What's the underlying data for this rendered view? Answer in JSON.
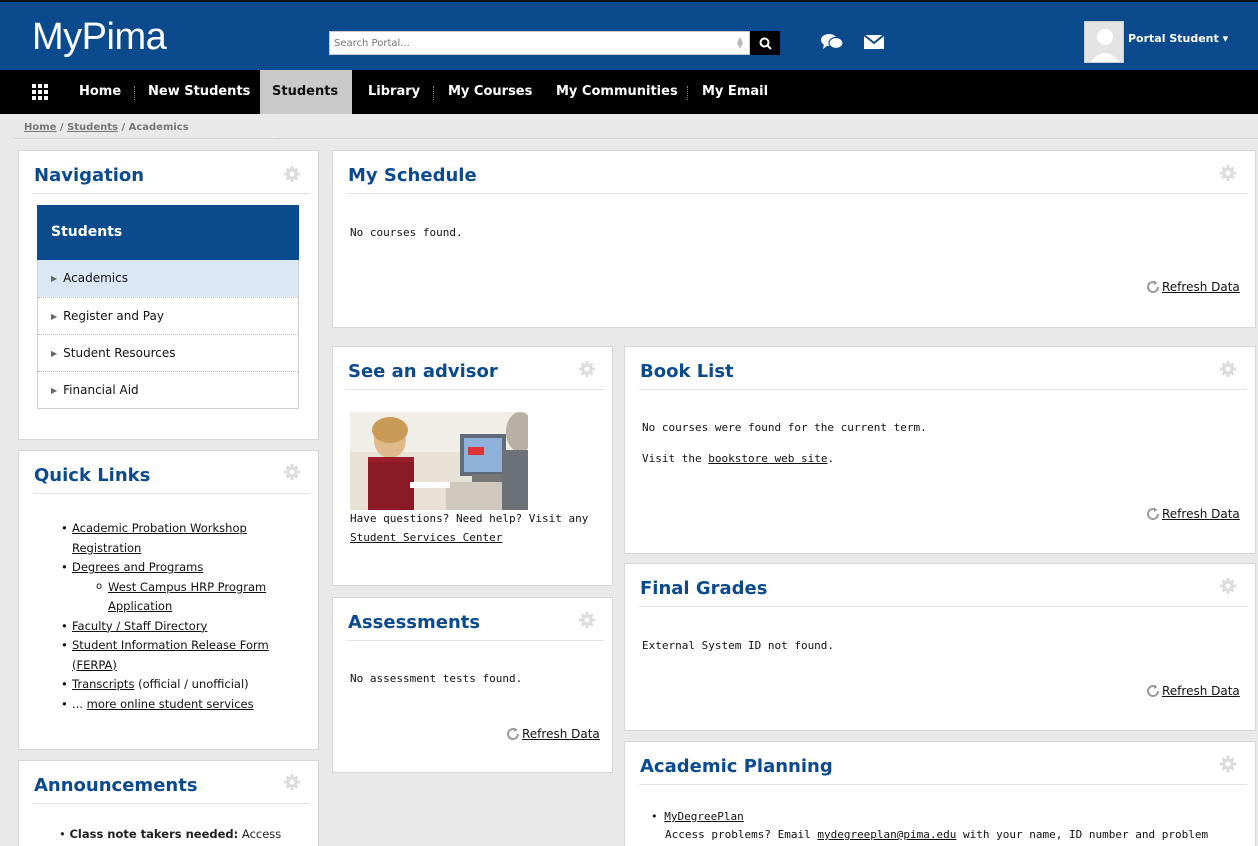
{
  "header": {
    "logo": "MyPima",
    "search_placeholder": "Search Portal...",
    "user_name": "Portal Student ▾"
  },
  "nav": {
    "items": [
      "Home",
      "New Students",
      "Students",
      "Library",
      "My Courses",
      "My Communities",
      "My Email"
    ],
    "active": "Students"
  },
  "breadcrumb": {
    "home": "Home",
    "sep1": " / ",
    "students": "Students",
    "current": " / Academics"
  },
  "navigation": {
    "title": "Navigation",
    "heading": "Students",
    "items": [
      "Academics",
      "Register and Pay",
      "Student Resources",
      "Financial Aid"
    ]
  },
  "quick_links": {
    "title": "Quick Links",
    "items": {
      "probation_1": "Academic Probation Workshop",
      "probation_2": "Registration",
      "degrees": "Degrees and Programs",
      "hrp_1": "West Campus HRP Program",
      "hrp_2": "Application",
      "faculty": "Faculty / Staff Directory",
      "ferpa_1": "Student Information Release Form",
      "ferpa_2": "(FERPA)",
      "transcripts_link": "Transcripts",
      "transcripts_rest": " (official / unofficial)",
      "more_prefix": "... ",
      "more_link": "more online student services"
    }
  },
  "announcements": {
    "title": "Announcements",
    "first_bold": "Class note takers needed:",
    "first_rest": "  Access"
  },
  "schedule": {
    "title": "My Schedule",
    "message": "No courses found.",
    "refresh": "Refresh Data"
  },
  "advisor": {
    "title": "See an advisor",
    "text": "Have questions? Need help? Visit any",
    "link": "Student Services Center"
  },
  "assessments": {
    "title": "Assessments",
    "message": "No assessment tests found.",
    "refresh": "Refresh Data"
  },
  "book_list": {
    "title": "Book List",
    "message": "No courses were found for the current term.",
    "visit_prefix": "Visit the ",
    "visit_link": "bookstore web site",
    "visit_suffix": ".",
    "refresh": "Refresh Data"
  },
  "final_grades": {
    "title": "Final Grades",
    "message": "External System ID not found.",
    "refresh": "Refresh Data"
  },
  "planning": {
    "title": "Academic Planning",
    "item_link": "MyDegreePlan",
    "line_prefix": "Access problems? Email ",
    "email": "mydegreeplan@pima.edu",
    "line_suffix": " with your name, ID number and problem"
  },
  "colors": {
    "brand_blue": "#0b4a8c",
    "nav_black": "#000000",
    "active_tab": "#c9c9c9",
    "selected_row": "#dbe7f5"
  }
}
